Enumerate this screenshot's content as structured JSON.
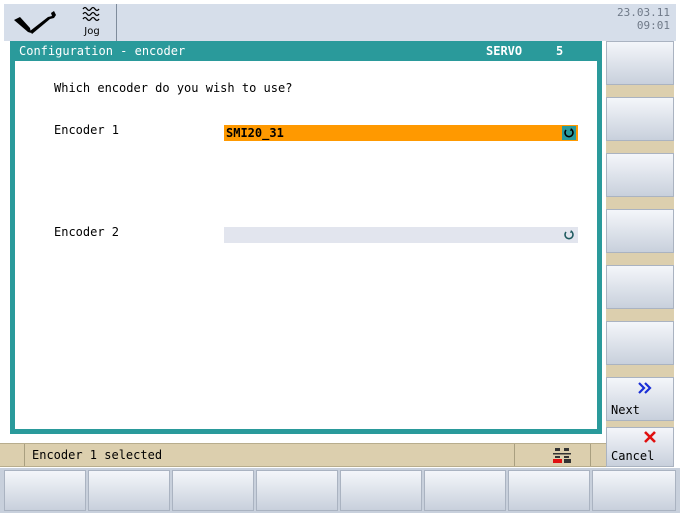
{
  "header": {
    "date": "23.03.11",
    "time": "09:01",
    "mode_label": "Jog",
    "icons": [
      "wrench-icon",
      "jog-wave-icon"
    ]
  },
  "dialog": {
    "title": "Configuration - encoder",
    "mode": "SERVO",
    "channel": "5",
    "question": "Which encoder do you wish to use?",
    "encoder1_label": "Encoder 1",
    "encoder1_value": "SMI20_31",
    "encoder2_label": "Encoder 2",
    "encoder2_value": ""
  },
  "softkeys": {
    "next_label": "Next",
    "cancel_label": "Cancel"
  },
  "status": {
    "message": "Encoder 1 selected",
    "rcs_icon": "rcs-icon"
  },
  "colors": {
    "title_bar": "#2a9a9b",
    "selected_field": "#ff9900",
    "empty_field": "#e2e5ee",
    "status_bar": "#dccfae"
  }
}
